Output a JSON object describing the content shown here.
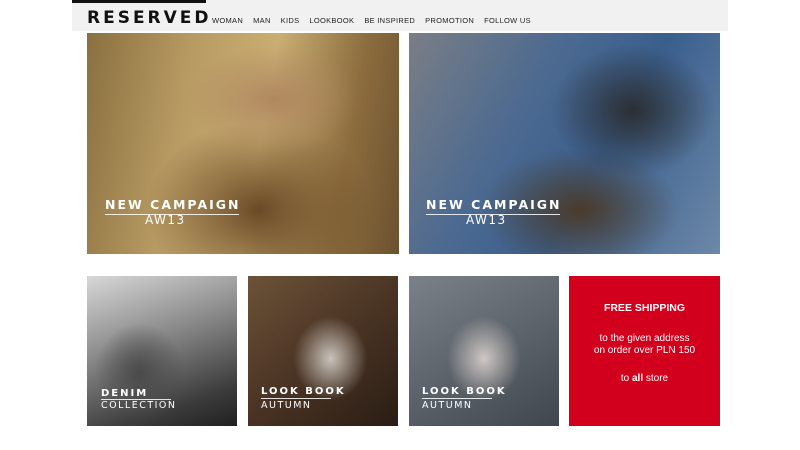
{
  "header": {
    "logo": "RESERVED",
    "nav": [
      "WOMAN",
      "MAN",
      "KIDS",
      "LOOKBOOK",
      "BE INSPIRED",
      "PROMOTION",
      "FOLLOW US"
    ]
  },
  "tiles": {
    "campaign_woman": {
      "line1": "NEW CAMPAIGN",
      "line2": "AW13"
    },
    "campaign_man": {
      "line1": "NEW CAMPAIGN",
      "line2": "AW13"
    },
    "denim": {
      "line1": "DENIM",
      "line2": "COLLECTION"
    },
    "lookbook_woman": {
      "line1": "LOOK BOOK",
      "line2": "AUTUMN"
    },
    "lookbook_man": {
      "line1": "LOOK BOOK",
      "line2": "AUTUMN"
    }
  },
  "promo": {
    "title": "FREE SHIPPING",
    "line1": "to the given address",
    "line2": "on order over PLN 150",
    "line3_prefix": "to ",
    "line3_bold": "all",
    "line3_suffix": " store",
    "background": "#d2001c"
  }
}
